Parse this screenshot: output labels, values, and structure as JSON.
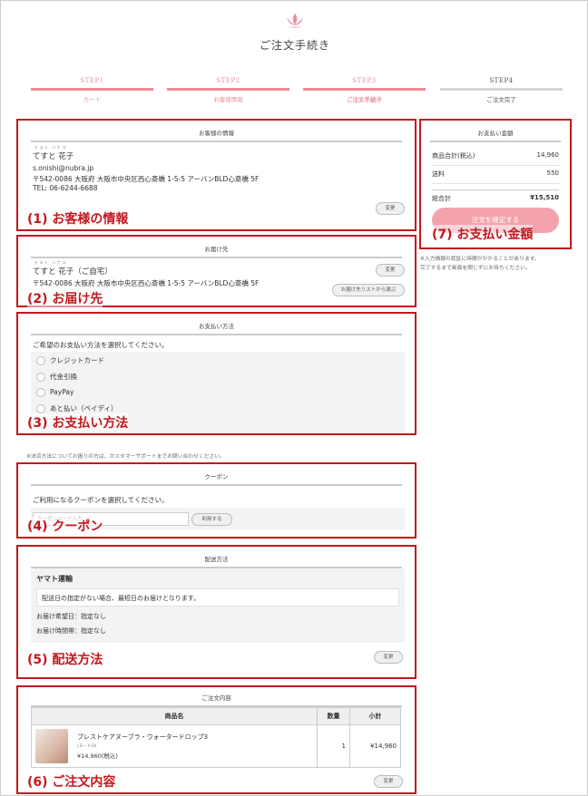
{
  "header": {
    "title": "ご注文手続き",
    "logo_icon": "lotus-logo-icon"
  },
  "steps": [
    {
      "num": "STEP1",
      "label": "カート"
    },
    {
      "num": "STEP2",
      "label": "お客様情報"
    },
    {
      "num": "STEP3",
      "label": "ご注文手続き"
    },
    {
      "num": "STEP4",
      "label": "ご注文完了"
    }
  ],
  "customer": {
    "heading": "お客様の情報",
    "ruby": "テスト ハナコ",
    "name": "てすと 花子",
    "email": "s.onishi@nubra.jp",
    "address": "〒542-0086 大阪府 大阪市中央区西心斎橋 1-5-5 アーバンBLD心斎橋 5F",
    "tel": "TEL: 06-6244-6688",
    "edit_label": "変更",
    "annotation": "(1) お客様の情報"
  },
  "delivery": {
    "heading": "お届け先",
    "ruby": "テスト ハナコ",
    "name": "てすと 花子（ご自宅）",
    "address": "〒542-0086 大阪府 大阪市中央区西心斎橋 1-5-5 アーバンBLD心斎橋 5F",
    "edit_label": "変更",
    "list_label": "お届け先リストから選ぶ",
    "annotation": "(2) お届け先"
  },
  "payment_method": {
    "heading": "お支払い方法",
    "prompt": "ご希望のお支払い方法を選択してください。",
    "options": [
      "クレジットカード",
      "代金引換",
      "PayPay",
      "あと払い（ペイディ）"
    ],
    "annotation": "(3) お支払い方法",
    "note": "※決済方法についてお困りの方は、カスタマーサポートまでお問い合わせください。"
  },
  "coupon": {
    "heading": "クーポン",
    "prompt": "ご利用になるクーポンを選択してください。",
    "input_placeholder": "クーポンコード入力",
    "apply_label": "利用する",
    "annotation": "(4) クーポン"
  },
  "shipping": {
    "heading": "配送方法",
    "carrier": "ヤマト運輸",
    "message": "配送日の指定がない場合、最短日のお届けとなります。",
    "date_label": "お届け希望日：指定なし",
    "time_label": "お届け時間帯：指定なし",
    "edit_label": "変更",
    "annotation": "(5) 配送方法"
  },
  "order": {
    "heading": "ご注文内容",
    "columns": [
      "商品名",
      "数量",
      "小計"
    ],
    "items": [
      {
        "name": "ブレストケアヌーブラ・ウォータードロップ3",
        "variant": "(ヌード/3)",
        "price": "¥14,960(税込)",
        "qty": "1",
        "subtotal": "¥14,960"
      }
    ],
    "edit_label": "変更",
    "annotation": "(6) ご注文内容"
  },
  "summary": {
    "heading": "お支払い金額",
    "rows": [
      {
        "label": "商品合計(税込)",
        "value": "14,960"
      },
      {
        "label": "送料",
        "value": "550"
      },
      {
        "label": "総合計",
        "value": "¥15,510"
      }
    ],
    "confirm_label": "注文を確定する",
    "annotation": "(7) お支払い金額",
    "note_line1": "※入力情報の認証に時間がかかることがあります。",
    "note_line2": "完了するまで画面を閉じずにお待ちください。"
  }
}
